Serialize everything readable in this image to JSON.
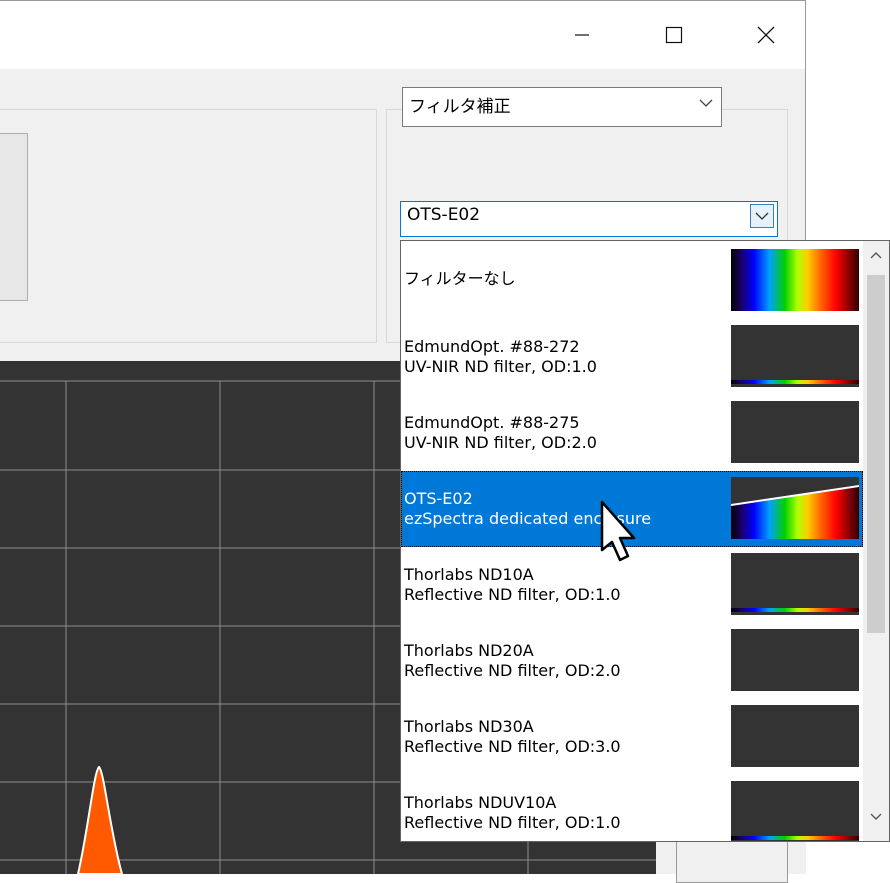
{
  "window": {
    "controls": {
      "minimize_icon": "minimize-icon",
      "maximize_icon": "maximize-icon",
      "close_icon": "close-icon"
    }
  },
  "filter_mode_combo": {
    "value": "フィルタ補正"
  },
  "filter_combo": {
    "value": "OTS-E02"
  },
  "dropdown": {
    "items": [
      {
        "line1": "フィルターなし",
        "line2": "",
        "selected": false,
        "thumb": "full-spectrum"
      },
      {
        "line1": "EdmundOpt. #88-272",
        "line2": "UV-NIR ND filter, OD:1.0",
        "selected": false,
        "thumb": "bottom-line"
      },
      {
        "line1": "EdmundOpt. #88-275",
        "line2": "UV-NIR ND filter, OD:2.0",
        "selected": false,
        "thumb": "empty"
      },
      {
        "line1": "OTS-E02",
        "line2": "ezSpectra dedicated enclosure",
        "selected": true,
        "thumb": "mid-spectrum"
      },
      {
        "line1": "Thorlabs ND10A",
        "line2": "Reflective ND filter, OD:1.0",
        "selected": false,
        "thumb": "bottom-line"
      },
      {
        "line1": "Thorlabs ND20A",
        "line2": "Reflective ND filter, OD:2.0",
        "selected": false,
        "thumb": "empty"
      },
      {
        "line1": "Thorlabs ND30A",
        "line2": "Reflective ND filter, OD:3.0",
        "selected": false,
        "thumb": "empty"
      },
      {
        "line1": "Thorlabs NDUV10A",
        "line2": "Reflective ND filter, OD:1.0",
        "selected": false,
        "thumb": "bottom-line"
      }
    ]
  },
  "colors": {
    "selection": "#0078d7",
    "plot_bg": "#333333",
    "grid": "#8c8c8c",
    "peak": "#ff5a00"
  }
}
